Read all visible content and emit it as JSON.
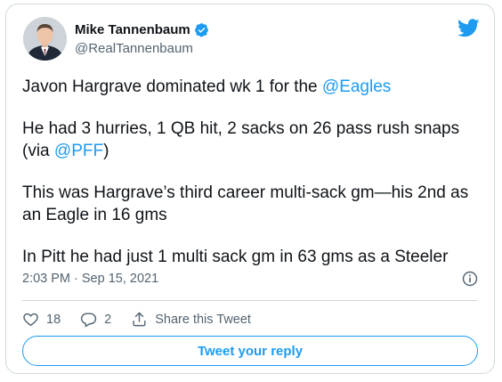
{
  "author": {
    "name": "Mike Tannenbaum",
    "handle": "@RealTannenbaum",
    "verified": true
  },
  "tweet": {
    "line1_prefix": "Javon Hargrave dominated wk 1 for the ",
    "line1_mention": "@Eagles",
    "line2_prefix": "He had 3 hurries, 1 QB hit, 2 sacks on 26 pass rush snaps (via ",
    "line2_mention": "@PFF",
    "line2_suffix": ")",
    "line3": "This was Hargrave’s third career multi-sack gm—his 2nd as an Eagle in 16 gms",
    "line4": "In Pitt he had just 1 multi sack gm in 63 gms as a Steeler"
  },
  "meta": {
    "timestamp": "2:03 PM · Sep 15, 2021"
  },
  "actions": {
    "like_count": "18",
    "reply_count": "2",
    "share_label": "Share this Tweet"
  },
  "reply_button": "Tweet your reply",
  "colors": {
    "accent": "#1d9bf0",
    "text": "#0f1419",
    "muted": "#536471",
    "border": "#cfd9de"
  },
  "icons": [
    "verified-badge-icon",
    "twitter-bird-icon",
    "info-icon",
    "heart-icon",
    "reply-bubble-icon",
    "share-icon"
  ]
}
